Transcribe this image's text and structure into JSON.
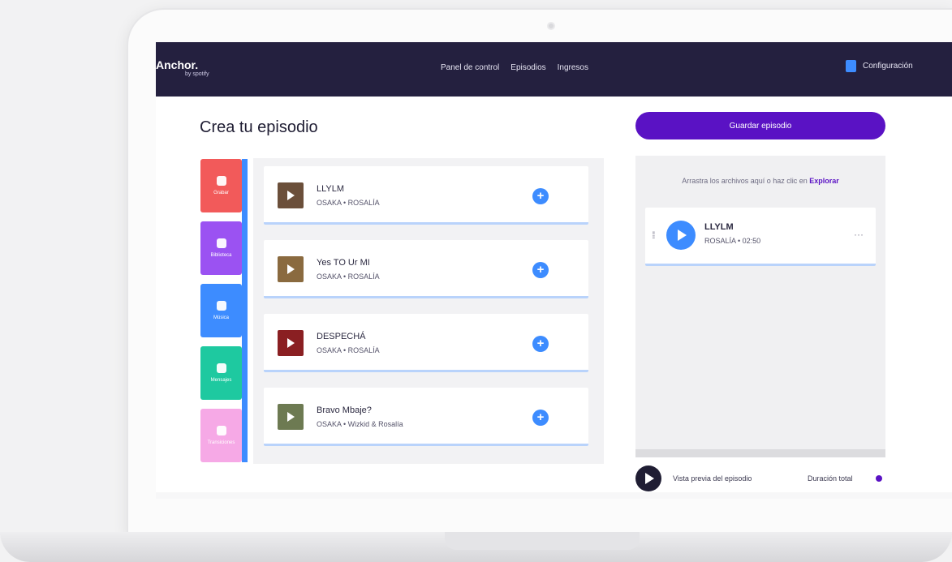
{
  "header": {
    "logo": "Anchor.",
    "logo_sub": "by spotify",
    "nav": [
      "Panel de control",
      "Episodios",
      "Ingresos"
    ],
    "settings_label": "Configuración"
  },
  "main": {
    "title": "Crea tu episodio",
    "save_label": "Guardar episodio"
  },
  "tabs": [
    {
      "label": "Grabar",
      "color": "#f25a5a",
      "icon": "microphone-icon"
    },
    {
      "label": "Biblioteca",
      "color": "#9b52f2",
      "icon": "folder-icon"
    },
    {
      "label": "Música",
      "color": "#3d8cff",
      "icon": "music-icon"
    },
    {
      "label": "Mensajes",
      "color": "#1ec9a0",
      "icon": "message-icon"
    },
    {
      "label": "Transiciones",
      "color": "#f6a9e6",
      "icon": "arrow-right-icon"
    }
  ],
  "tracks": [
    {
      "title": "LLYLM",
      "meta": "OSAKA • ROSALÍA",
      "cover": "#6b4f3a"
    },
    {
      "title": "Yes TO Ur MI",
      "meta": "OSAKA • ROSALÍA",
      "cover": "#8a6a3f"
    },
    {
      "title": "DESPECHÁ",
      "meta": "OSAKA • ROSALÍA",
      "cover": "#8a1f22"
    },
    {
      "title": "Bravo Mbaje?",
      "meta": "OSAKA • Wizkid & Rosalía",
      "cover": "#6d7a52"
    }
  ],
  "episode_panel": {
    "dropzone_text": "Arrastra los archivos aquí o haz clic en ",
    "dropzone_link": "Explorar",
    "track": {
      "title": "LLYLM",
      "meta": "ROSALÍA • 02:50"
    }
  },
  "footer": {
    "preview_label": "Vista previa del episodio",
    "duration_label": "Duración total"
  }
}
